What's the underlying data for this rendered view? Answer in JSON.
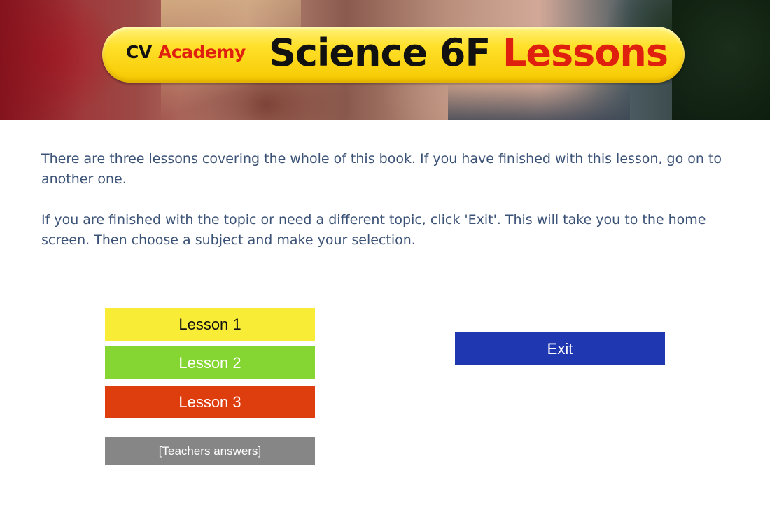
{
  "header": {
    "brand_cv": "CV",
    "brand_academy": "Academy",
    "title_main": "Science 6F",
    "title_accent": "Lessons"
  },
  "intro": {
    "paragraph_1": "There are three lessons covering the whole of this book. If you have finished with this lesson, go on to another one.",
    "paragraph_2": "If you are finished with the topic or need a different topic, click 'Exit'. This will take you to the home screen. Then choose a subject and make your selection."
  },
  "lessons": [
    {
      "label": "Lesson 1",
      "color": "#f9ec36"
    },
    {
      "label": "Lesson 2",
      "color": "#86d633"
    },
    {
      "label": "Lesson 3",
      "color": "#de3d0e"
    }
  ],
  "teachers_answers": {
    "label": "[Teachers answers]",
    "color": "#868686"
  },
  "exit": {
    "label": "Exit",
    "color": "#1f37b0"
  },
  "colors": {
    "text": "#3b5277",
    "title_pill": "#ffe02a",
    "title_accent": "#e0200f"
  }
}
